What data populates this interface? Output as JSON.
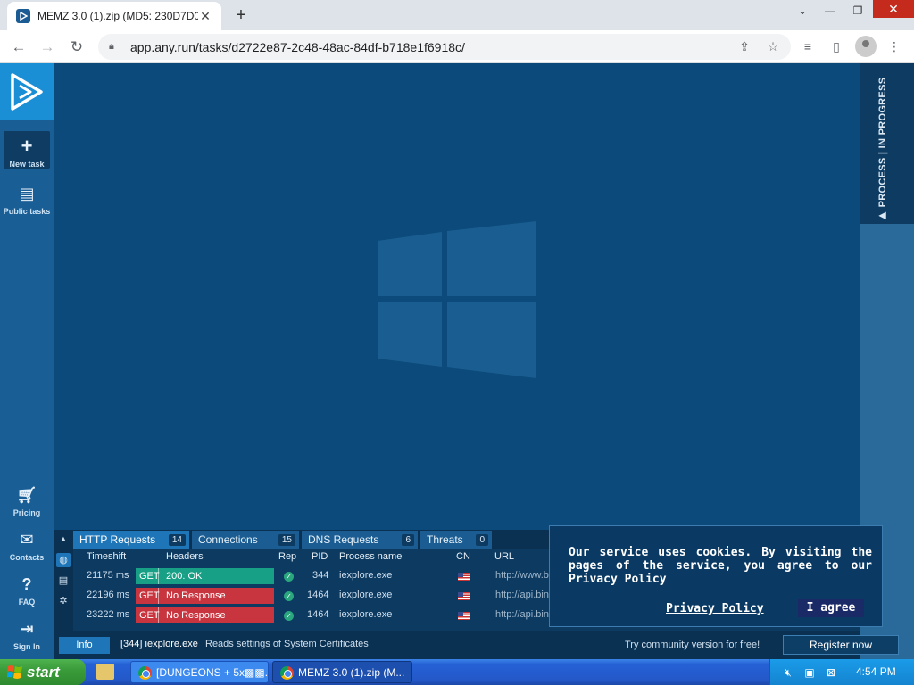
{
  "browser": {
    "tab_title": "MEMZ 3.0 (1).zip (MD5: 230D7D0",
    "tab_close": "✕",
    "new_tab": "+",
    "url": "app.any.run/tasks/d2722e87-2c48-48ac-84df-b718e1f6918c/"
  },
  "sidebar": {
    "items": [
      {
        "label": "New task",
        "icon": "plus-icon"
      },
      {
        "label": "Public tasks",
        "icon": "document-icon"
      },
      {
        "label": "Pricing",
        "icon": "cart-icon"
      },
      {
        "label": "Contacts",
        "icon": "mail-icon"
      },
      {
        "label": "FAQ",
        "icon": "question-icon"
      },
      {
        "label": "Sign In",
        "icon": "sign-in-icon"
      }
    ]
  },
  "right_panel": {
    "label": "PROCESS | IN PROGRESS"
  },
  "panel": {
    "tabs": [
      {
        "label": "HTTP Requests",
        "count": "14"
      },
      {
        "label": "Connections",
        "count": "15"
      },
      {
        "label": "DNS Requests",
        "count": "6"
      },
      {
        "label": "Threats",
        "count": "0"
      }
    ],
    "columns": [
      "Timeshift",
      "Headers",
      "Rep",
      "PID",
      "Process name",
      "CN",
      "URL"
    ],
    "rows": [
      {
        "timeshift": "21175 ms",
        "method": "GET",
        "status": "200: OK",
        "pid": "344",
        "process": "iexplore.exe",
        "url": "http://www.bing"
      },
      {
        "timeshift": "22196 ms",
        "method": "GET",
        "status": "No Response",
        "pid": "1464",
        "process": "iexplore.exe",
        "url": "http://api.bing.com/qsml.aspx?query=about"
      },
      {
        "timeshift": "23222 ms",
        "method": "GET",
        "status": "No Response",
        "pid": "1464",
        "process": "iexplore.exe",
        "url": "http://api.bing.com/qsml.aspx?query="
      }
    ]
  },
  "statusbar": {
    "info": "Info",
    "process": "[344] iexplore.exe",
    "message": "Reads settings of System Certificates",
    "community": "Try community version for free!",
    "register": "Register now"
  },
  "cookie": {
    "text": "Our service uses cookies. By visiting the pages of the service, you agree to our Privacy Policy",
    "link": "Privacy Policy",
    "agree": "I agree"
  },
  "taskbar": {
    "start": "start",
    "items": [
      "[DUNGEONS + 5x▩▩...",
      "MEMZ 3.0 (1).zip (M..."
    ],
    "clock": "4:54 PM"
  },
  "colors": {
    "ok": "#17a085",
    "error": "#c8353f",
    "accent": "#1e76b8",
    "desktop": "#0b4a7a"
  }
}
